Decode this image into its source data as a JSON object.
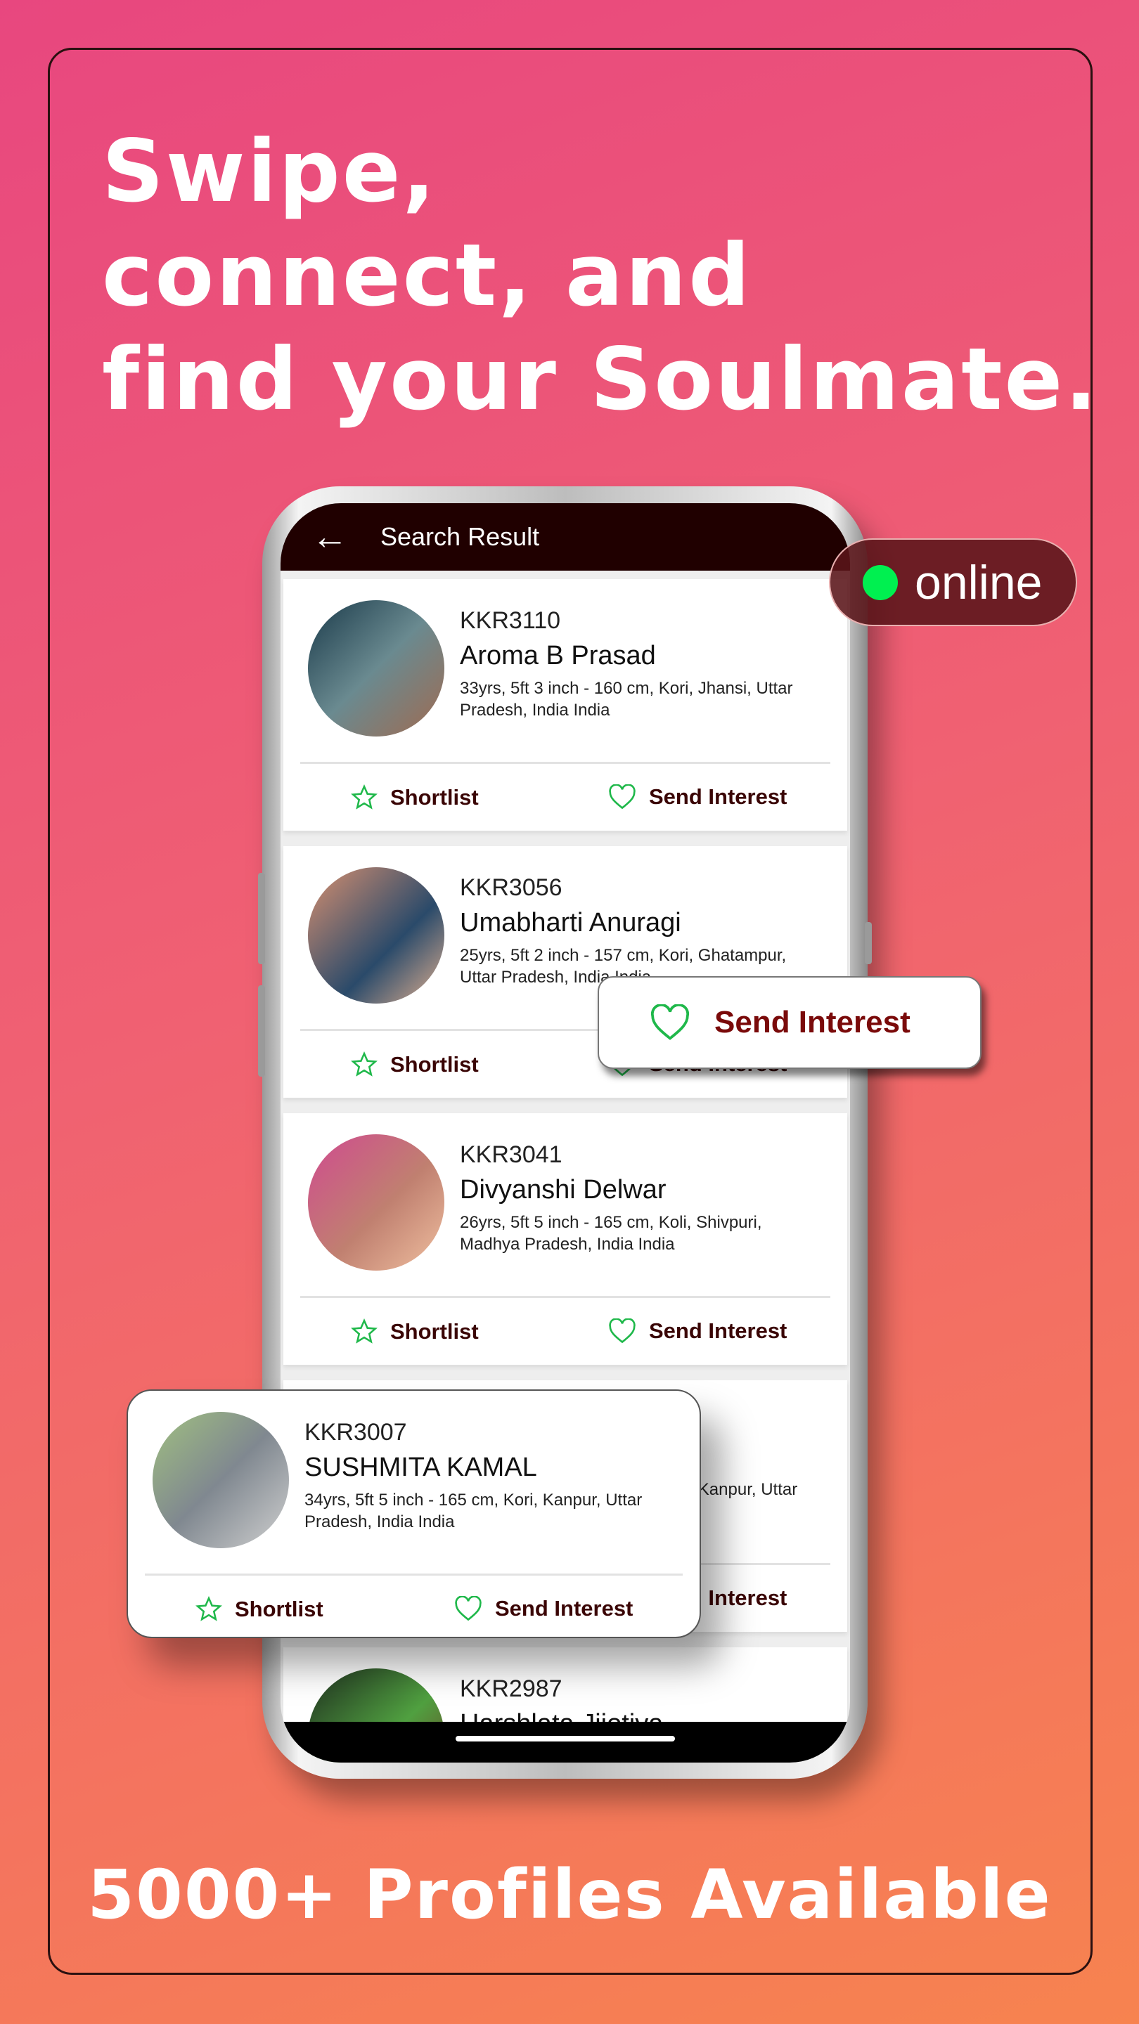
{
  "headline": [
    "Swipe,",
    "connect, and",
    "find your Soulmate."
  ],
  "footer": "5000+ Profiles Available",
  "app": {
    "title": "Search Result",
    "back_icon": "arrow-left-icon"
  },
  "online_badge": {
    "label": "online",
    "color": "#00f050"
  },
  "send_interest_popup": {
    "label": "Send Interest",
    "icon": "heart-outline-icon"
  },
  "actions": {
    "shortlist": "Shortlist",
    "send_interest": "Send Interest"
  },
  "colors": {
    "accent": "#200000",
    "action_text": "#3a0505",
    "icon_green": "#1fb84a",
    "bg_start": "#e8477f",
    "bg_end": "#f7834f"
  },
  "profiles": [
    {
      "id": "KKR3110",
      "name": "Aroma B Prasad",
      "details": "33yrs, 5ft 3 inch - 160 cm, Kori, Jhansi, Uttar Pradesh, India India"
    },
    {
      "id": "KKR3056",
      "name": "Umabharti Anuragi",
      "details": "25yrs, 5ft 2 inch - 157 cm, Kori, Ghatampur, Uttar Pradesh, India India"
    },
    {
      "id": "KKR3041",
      "name": "Divyanshi Delwar",
      "details": "26yrs, 5ft 5 inch - 165 cm, Koli, Shivpuri, Madhya Pradesh, India India"
    },
    {
      "id": "KKR3007",
      "name": "SUSHMITA KAMAL",
      "details": "34yrs, 5ft 5 inch - 165 cm, Kori, Kanpur, Uttar Pradesh, India India"
    },
    {
      "id": "KKR2987",
      "name": "Harshlata Jijotiya",
      "details": ""
    }
  ],
  "featured_profile": {
    "id": "KKR3007",
    "name": "SUSHMITA KAMAL",
    "details": "34yrs, 5ft 5 inch - 165 cm, Kori, Kanpur, Uttar Pradesh, India India"
  }
}
